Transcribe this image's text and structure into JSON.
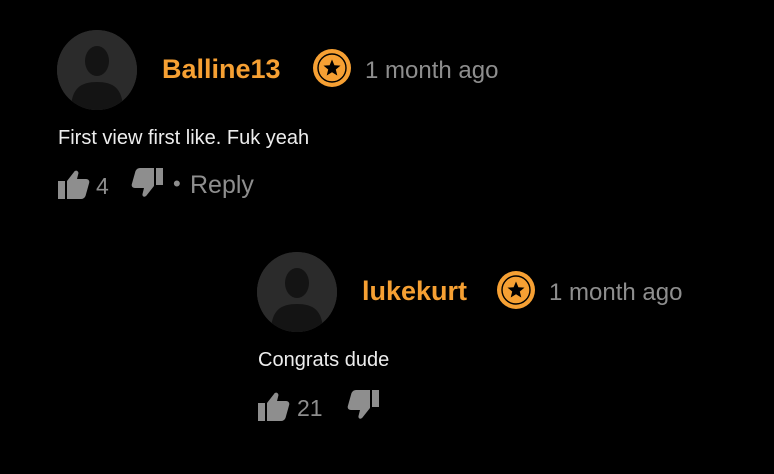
{
  "colors": {
    "background": "#000000",
    "username": "#f6a033",
    "muted": "#8e8e8e",
    "text": "#ededed",
    "badge": "#f6a033",
    "avatar": "#2a2a2a"
  },
  "comments": [
    {
      "username": "Balline13",
      "badge_icon": "star-badge-icon",
      "timestamp": "1 month ago",
      "text": "First view first like. Fuk yeah",
      "likes": "4",
      "dot": "•",
      "reply_label": "Reply"
    },
    {
      "username": "lukekurt",
      "badge_icon": "star-badge-icon",
      "timestamp": "1 month ago",
      "text": "Congrats dude",
      "likes": "21"
    }
  ]
}
